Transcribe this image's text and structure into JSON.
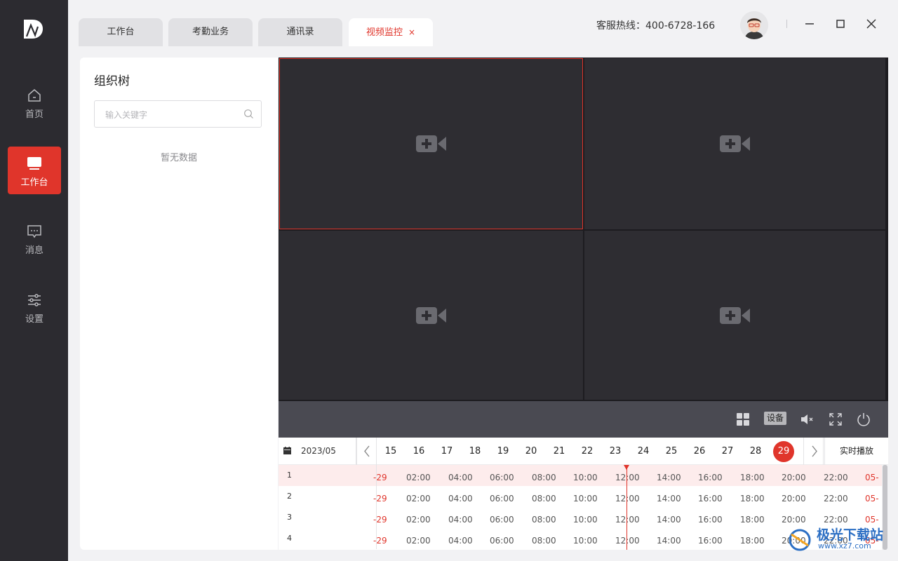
{
  "app": {
    "logo_icon": "app-logo-icon"
  },
  "sidebar": {
    "items": [
      {
        "label": "首页",
        "icon": "home-icon",
        "active": false
      },
      {
        "label": "工作台",
        "icon": "monitor-icon",
        "active": true
      },
      {
        "label": "消息",
        "icon": "message-icon",
        "active": false
      },
      {
        "label": "设置",
        "icon": "sliders-icon",
        "active": false
      }
    ]
  },
  "tabs": [
    {
      "label": "工作台",
      "active": false
    },
    {
      "label": "考勤业务",
      "active": false
    },
    {
      "label": "通讯录",
      "active": false
    },
    {
      "label": "视频监控",
      "active": true,
      "close": "×"
    }
  ],
  "header": {
    "hotline": "客服热线：400-6728-166"
  },
  "org": {
    "title": "组织树",
    "search_placeholder": "输入关键字",
    "empty_text": "暂无数据"
  },
  "controls": {
    "device_label": "设备"
  },
  "timeline": {
    "month": "2023/05",
    "days": [
      "15",
      "16",
      "17",
      "18",
      "19",
      "20",
      "21",
      "22",
      "23",
      "24",
      "25",
      "26",
      "27",
      "28",
      "29"
    ],
    "active_day": "29",
    "live_label": "实时播放",
    "tracks": [
      "1",
      "2",
      "3",
      "4"
    ],
    "ticks": [
      "-29",
      "02:00",
      "04:00",
      "06:00",
      "08:00",
      "10:00",
      "12:00",
      "14:00",
      "16:00",
      "18:00",
      "20:00",
      "22:00",
      "05-"
    ]
  },
  "watermark": {
    "text": "极光下载站",
    "url": "www.xz7.com"
  },
  "colors": {
    "accent": "#e0352b",
    "sidebar_bg": "#2c2b30",
    "video_bg": "#2e2d32"
  }
}
